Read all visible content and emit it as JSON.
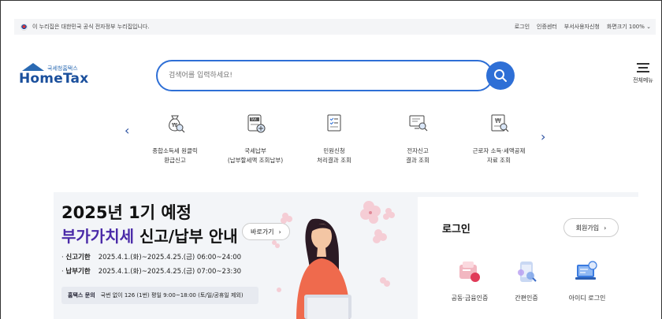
{
  "gov_bar": {
    "notice": "이 누리집은 대한민국 공식 전자정부 누리집입니다.",
    "links": [
      "로그인",
      "인증센터",
      "부서사용자신청",
      "화면크기 100%"
    ]
  },
  "logo": {
    "small_text": "국세청홈택스",
    "brand": "HomeTax"
  },
  "search": {
    "placeholder": "검색어를 입력하세요!"
  },
  "menu": {
    "label": "전체메뉴"
  },
  "quick_services": [
    {
      "icon": "money-bag-search-icon",
      "line1": "종합소득세 원클릭",
      "line2": "환급신고"
    },
    {
      "icon": "tax-payment-icon",
      "line1": "국세납부",
      "line2": "(납부할세액 조회납부)"
    },
    {
      "icon": "document-check-icon",
      "line1": "민원신청",
      "line2": "처리결과 조회"
    },
    {
      "icon": "monitor-search-icon",
      "line1": "전자신고",
      "line2": "결과 조회"
    },
    {
      "icon": "won-document-search-icon",
      "line1": "근로자 소득·세액공제",
      "line2": "자료 조회"
    }
  ],
  "banner": {
    "line1": "2025년 1기 예정",
    "line2_highlight": "부가가치세",
    "line2_rest": " 신고/납부 안내",
    "shortcut_label": "바로가기",
    "periods": [
      {
        "label": "신고기한",
        "value": "2025.4.1.(화)~2025.4.25.(금) 06:00~24:00"
      },
      {
        "label": "납부기한",
        "value": "2025.4.1.(화)~2025.4.25.(금) 07:00~23:30"
      }
    ],
    "contact_label": "홈택스 문의",
    "contact_value": "국번 없이 126 (1번)   평일 9:00~18:00 (토/일/공휴일 제외)"
  },
  "login": {
    "title": "로그인",
    "join_label": "회원가입",
    "methods": [
      {
        "icon": "joint-certificate-icon",
        "label": "공동·금융인증"
      },
      {
        "icon": "simple-auth-icon",
        "label": "간편인증"
      },
      {
        "icon": "id-login-icon",
        "label": "아이디 로그인"
      }
    ]
  },
  "colors": {
    "brand_blue": "#2e6fd6",
    "highlight_purple": "#4a2aa8",
    "banner_bg": "#f3f5f8"
  }
}
